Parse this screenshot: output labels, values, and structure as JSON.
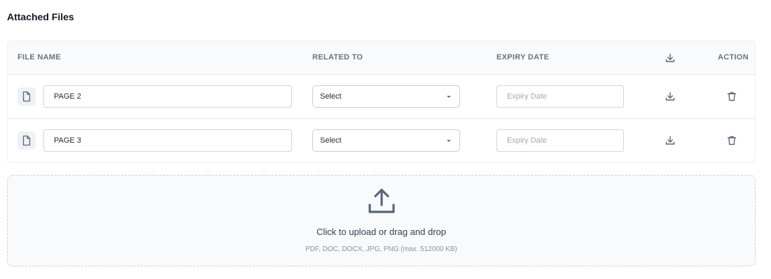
{
  "section": {
    "title": "Attached Files"
  },
  "table": {
    "headers": {
      "file_name": "FILE NAME",
      "related_to": "RELATED TO",
      "expiry_date": "EXPIRY DATE",
      "download_icon": "download-icon",
      "action": "ACTION"
    },
    "rows": [
      {
        "file_icon": "file-icon",
        "file_name": "PAGE 2",
        "related_to": "Select",
        "expiry_date": "",
        "expiry_placeholder": "Expiry Date",
        "download_icon": "download-icon",
        "delete_icon": "trash-icon"
      },
      {
        "file_icon": "file-icon",
        "file_name": "PAGE 3",
        "related_to": "Select",
        "expiry_date": "",
        "expiry_placeholder": "Expiry Date",
        "download_icon": "download-icon",
        "delete_icon": "trash-icon"
      }
    ]
  },
  "upload": {
    "icon": "upload-icon",
    "main_text": "Click to upload or drag and drop",
    "sub_text": "PDF, DOC, DOCX, JPG, PNG (max. 512000 KB)"
  },
  "colors": {
    "icon": "#5b6678",
    "header_bg": "#f9fafb",
    "dropzone_bg": "#f8fafc",
    "border": "#e5e7eb"
  }
}
